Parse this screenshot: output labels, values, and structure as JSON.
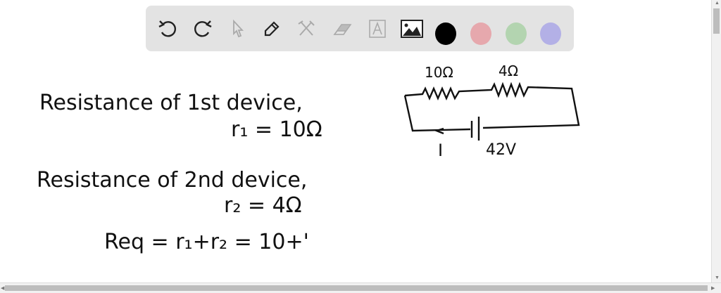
{
  "toolbar": {
    "tools": [
      "undo-icon",
      "redo-icon",
      "select-icon",
      "pen-icon",
      "tools-icon",
      "eraser-icon",
      "text-icon",
      "image-icon"
    ],
    "colors": {
      "black": "#000000",
      "pink": "#e6a8ad",
      "green": "#b3d4b0",
      "purple": "#b3b0e6"
    }
  },
  "board": {
    "line1": "Resistance of 1st device,",
    "line2": "r₁ = 10Ω",
    "line3": "Resistance of 2nd device,",
    "line4": "r₂ = 4Ω",
    "line5": "Req = r₁+r₂ = 10+'",
    "circuit": {
      "r1_label": "10Ω",
      "r2_label": "4Ω",
      "current_label": "I",
      "voltage_label": "42V"
    }
  }
}
